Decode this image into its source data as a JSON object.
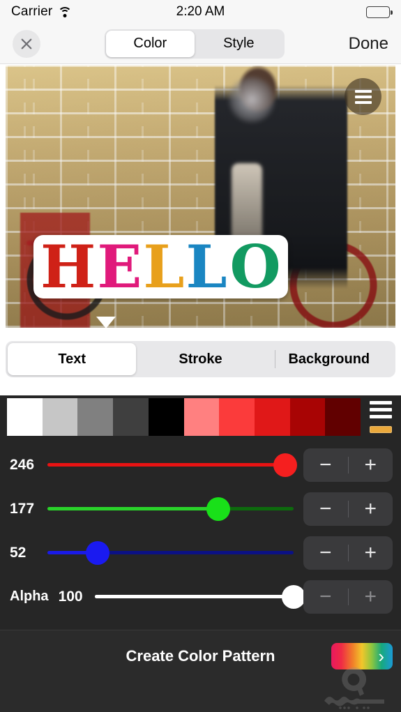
{
  "status_bar": {
    "carrier": "Carrier",
    "wifi_icon": "wifi-icon",
    "time": "2:20 AM",
    "battery_icon": "battery-full-icon"
  },
  "navbar": {
    "close_icon": "close-x-icon",
    "segments": [
      {
        "label": "Color",
        "active": true
      },
      {
        "label": "Style",
        "active": false
      }
    ],
    "done_label": "Done"
  },
  "canvas": {
    "overlay_menu_icon": "hamburger-menu-icon",
    "artwork_text": "HELLO",
    "letters": [
      {
        "char": "H",
        "color": "#cf2117"
      },
      {
        "char": "E",
        "color": "#e01a7b"
      },
      {
        "char": "L",
        "color": "#e8a01c"
      },
      {
        "char": "L",
        "color": "#1a86c2"
      },
      {
        "char": "O",
        "color": "#129a61"
      }
    ],
    "handle_icon": "drag-handle-triangle-icon"
  },
  "target_tabs": [
    {
      "label": "Text",
      "active": true
    },
    {
      "label": "Stroke",
      "active": false
    },
    {
      "label": "Background",
      "active": false
    }
  ],
  "palette": {
    "swatches": [
      "#ffffff",
      "#c6c6c6",
      "#808080",
      "#3f3f3f",
      "#000000",
      "#ff8080",
      "#fb3b3b",
      "#e01818",
      "#a80404",
      "#610000"
    ],
    "menu_icon": "palette-menu-icon",
    "accent_color": "#eaa83c"
  },
  "sliders": [
    {
      "name": "red",
      "label": "246",
      "value": 246,
      "max": 255,
      "track_color": "#8a0f0f",
      "fill_color": "#e81313",
      "thumb_color": "#f51f1f",
      "minus_label": "−",
      "plus_label": "+"
    },
    {
      "name": "green",
      "label": "177",
      "value": 177,
      "max": 255,
      "track_color": "#0d6a0d",
      "fill_color": "#2ad22a",
      "thumb_color": "#19e019",
      "minus_label": "−",
      "plus_label": "+"
    },
    {
      "name": "blue",
      "label": "52",
      "value": 52,
      "max": 255,
      "track_color": "#0b1185",
      "fill_color": "#1a1ae8",
      "thumb_color": "#1a1af0",
      "minus_label": "−",
      "plus_label": "+"
    }
  ],
  "alpha": {
    "label": "Alpha",
    "value_label": "100",
    "value": 100,
    "max": 100,
    "track_color": "#ffffff",
    "thumb_color": "#ffffff",
    "minus_label": "−",
    "plus_label": "+"
  },
  "bottom_bar": {
    "create_pattern_label": "Create Color Pattern",
    "pattern_button_icon": "chevron-right-icon",
    "chevron": "›",
    "watermark_icon": "app-watermark-logo"
  }
}
